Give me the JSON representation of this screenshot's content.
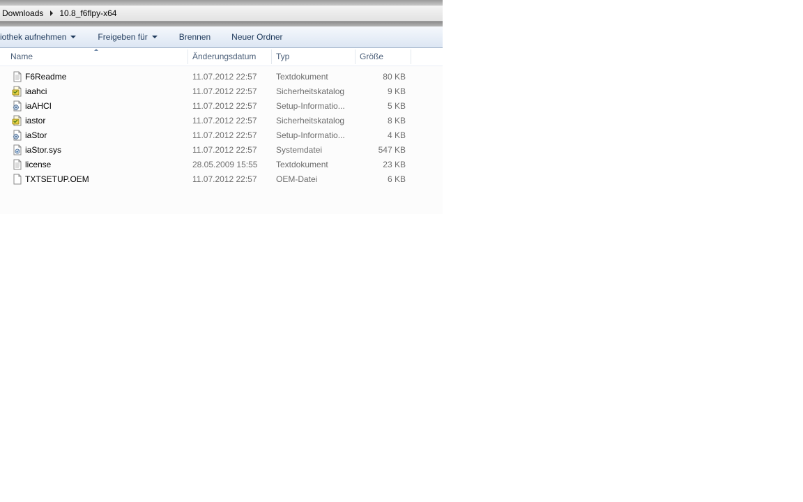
{
  "breadcrumb": {
    "items": [
      "Downloads",
      "10.8_f6flpy-x64"
    ]
  },
  "toolbar": {
    "library_label": "iothek aufnehmen",
    "share_label": "Freigeben für",
    "burn_label": "Brennen",
    "new_folder_label": "Neuer Ordner"
  },
  "columns": {
    "name": "Name",
    "date": "Änderungsdatum",
    "type": "Typ",
    "size": "Größe"
  },
  "files": [
    {
      "name": "F6Readme",
      "date": "11.07.2012 22:57",
      "type": "Textdokument",
      "size": "80 KB",
      "icon": "text-file-icon"
    },
    {
      "name": "iaahci",
      "date": "11.07.2012 22:57",
      "type": "Sicherheitskatalog",
      "size": "9 KB",
      "icon": "security-catalog-icon"
    },
    {
      "name": "iaAHCI",
      "date": "11.07.2012 22:57",
      "type": "Setup-Informatio...",
      "size": "5 KB",
      "icon": "setup-info-icon"
    },
    {
      "name": "iastor",
      "date": "11.07.2012 22:57",
      "type": "Sicherheitskatalog",
      "size": "8 KB",
      "icon": "security-catalog-icon"
    },
    {
      "name": "iaStor",
      "date": "11.07.2012 22:57",
      "type": "Setup-Informatio...",
      "size": "4 KB",
      "icon": "setup-info-icon"
    },
    {
      "name": "iaStor.sys",
      "date": "11.07.2012 22:57",
      "type": "Systemdatei",
      "size": "547 KB",
      "icon": "system-file-icon"
    },
    {
      "name": "license",
      "date": "28.05.2009 15:55",
      "type": "Textdokument",
      "size": "23 KB",
      "icon": "text-file-icon"
    },
    {
      "name": "TXTSETUP.OEM",
      "date": "11.07.2012 22:57",
      "type": "OEM-Datei",
      "size": "6 KB",
      "icon": "blank-file-icon"
    }
  ]
}
